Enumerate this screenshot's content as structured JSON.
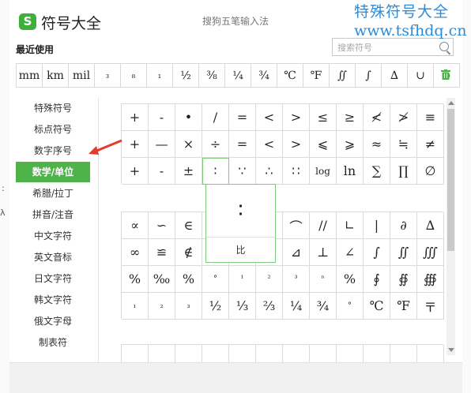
{
  "window": {
    "logo_letter": "S",
    "title": "符号大全",
    "ime_name": "搜狗五笔输入法"
  },
  "watermark": {
    "line1": "特殊符号大全",
    "line2": "www.tsfhdq.cn"
  },
  "recent": {
    "label": "最近使用",
    "items": [
      "mm",
      "km",
      "mil",
      "₃",
      "₈",
      "₁",
      "½",
      "⅜",
      "¼",
      "¾",
      "℃",
      "℉",
      "∬",
      "∫",
      "∆",
      "∪",
      "∞"
    ]
  },
  "search": {
    "placeholder": "搜索符号"
  },
  "sidebar": {
    "items": [
      "特殊符号",
      "标点符号",
      "数字序号",
      "数学/单位",
      "希腊/拉丁",
      "拼音/注音",
      "中文字符",
      "英文音标",
      "日文字符",
      "韩文字符",
      "俄文字母",
      "制表符"
    ],
    "active": "数学/单位"
  },
  "grid": {
    "rows": [
      [
        "+",
        "-",
        "•",
        "/",
        "=",
        "<",
        ">",
        "≤",
        "≥",
        "≮",
        "≯",
        "≡"
      ],
      [
        "+",
        "—",
        "×",
        "÷",
        "=",
        "<",
        ">",
        "⩽",
        "⩾",
        "≈",
        "≒",
        "≠"
      ],
      [
        "+",
        "-",
        "±",
        "∶",
        "∵",
        "∴",
        "∷",
        "log",
        "ln",
        "∑",
        "∏",
        "∅"
      ],
      [
        "∝",
        "∽",
        "∈",
        "∩",
        "",
        "",
        "⌒",
        "//",
        "∟",
        "|",
        "∂",
        "∆"
      ],
      [
        "∞",
        "≌",
        "∉",
        "∪",
        "",
        "",
        "⊿",
        "⊥",
        "∠",
        "∫",
        "∬",
        "∭"
      ],
      [
        "%",
        "‰",
        "%",
        "°",
        "¹",
        "²",
        "³",
        "ⁿ",
        "%",
        "∮",
        "∯",
        "∰"
      ],
      [
        "₁",
        "₂",
        "₃",
        "½",
        "⅓",
        "⅔",
        "¼",
        "¾",
        "°",
        "℃",
        "℉",
        "〒"
      ],
      [
        "",
        "",
        "",
        "",
        "",
        "",
        "",
        "",
        "",
        "",
        "",
        ""
      ]
    ]
  },
  "popup": {
    "symbol": "∶",
    "name": "比"
  }
}
